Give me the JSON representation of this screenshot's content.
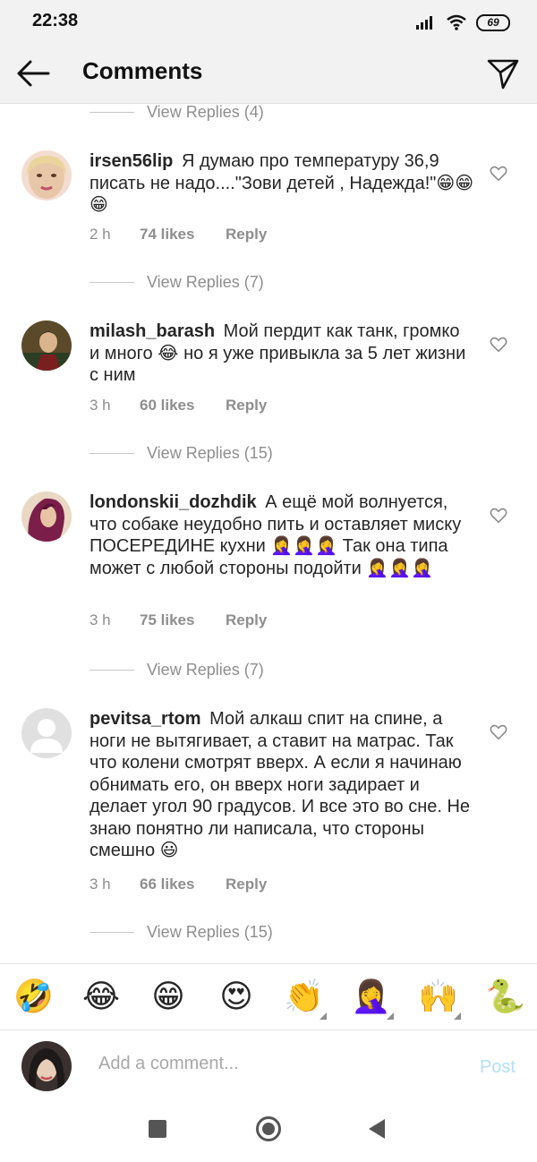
{
  "status_bar": {
    "time": "22:38",
    "battery": "69"
  },
  "header": {
    "title": "Comments"
  },
  "view_replies": [
    "View Replies (4)",
    "View Replies (7)",
    "View Replies (15)",
    "View Replies (7)",
    "View Replies (15)"
  ],
  "comments": [
    {
      "username": "irsen56lip",
      "text": "Я думаю про температуру 36,9 писать не надо....\"Зови детей , Надежда!\"😁😁😁",
      "time": "2 h",
      "likes": "74 likes",
      "reply": "Reply"
    },
    {
      "username": "milash_barash",
      "text": "Мой пердит как танк, громко и много 😂 но я уже привыкла за 5 лет жизни с ним",
      "time": "3 h",
      "likes": "60 likes",
      "reply": "Reply"
    },
    {
      "username": "londonskii_dozhdik",
      "text": "А ещё мой волнуется, что собаке неудобно пить и оставляет миску ПОСЕРЕДИНЕ кухни 🤦‍♀️🤦‍♀️🤦‍♀️ Так она типа может с любой стороны подойти 🤦‍♀️🤦‍♀️🤦‍♀️",
      "time": "3 h",
      "likes": "75 likes",
      "reply": "Reply"
    },
    {
      "username": "pevitsa_rtom",
      "text": "Мой алкаш спит на спине, а ноги не вытягивает, а ставит на матрас. Так что колени смотрят вверх. А если я начинаю обнимать его, он вверх ноги задирает и делает угол 90 градусов. И все это во сне. Не знаю понятно ли написала, что стороны смешно 😃",
      "time": "3 h",
      "likes": "66 likes",
      "reply": "Reply"
    }
  ],
  "emoji_bar": [
    "🤣",
    "😂",
    "😁",
    "😍",
    "👏",
    "🤦‍♀️",
    "🙌",
    "🐍"
  ],
  "composer": {
    "placeholder": "Add a comment...",
    "post_label": "Post"
  },
  "colors": {
    "link_disabled": "#b2dffc",
    "secondary_text": "#8e8e8e",
    "primary_text": "#262626"
  }
}
